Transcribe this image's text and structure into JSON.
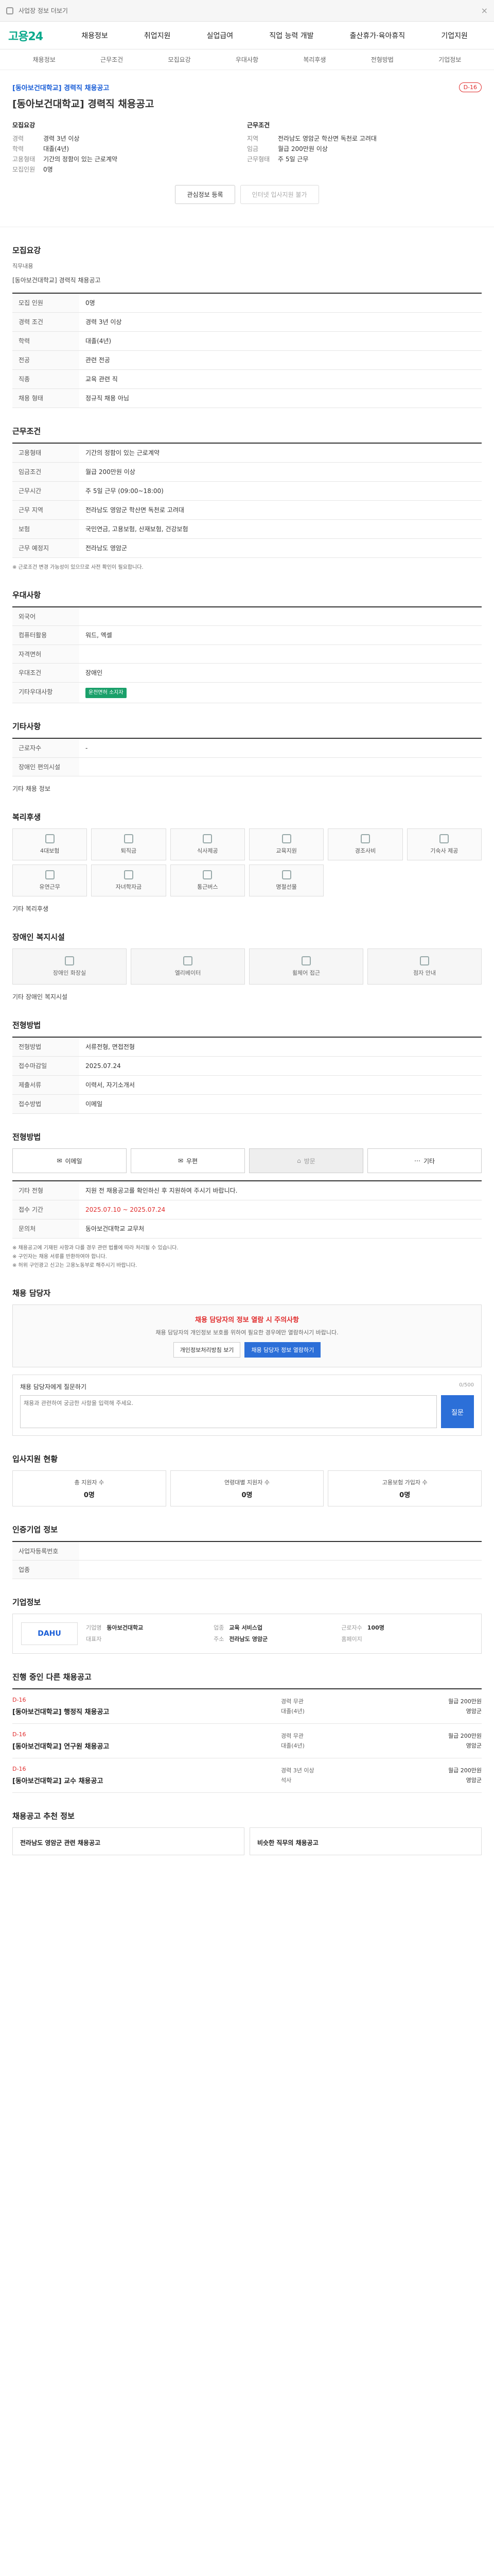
{
  "topbar": {
    "notice": "사업장 정보 더보기",
    "close": "×"
  },
  "gnb": {
    "logo_a": "고용",
    "logo_b": "24",
    "menu": [
      "채용정보",
      "취업지원",
      "실업급여",
      "직업 능력 개발",
      "출산휴가·육아휴직",
      "기업지원"
    ]
  },
  "subnav": [
    "채용정보",
    "근무조건",
    "모집요강",
    "우대사항",
    "복리후생",
    "전형방법",
    "기업정보"
  ],
  "job": {
    "company": "[동아보건대학교] 경력직 채용공고",
    "title": "[동아보건대학교] 경력직 채용공고",
    "badge": "D-16",
    "left_h": "모집요강",
    "right_h": "근무조건",
    "left": [
      [
        "경력",
        "경력 3년 이상"
      ],
      [
        "학력",
        "대졸(4년)"
      ],
      [
        "고용형태",
        "기간의 정함이 있는 근로계약"
      ],
      [
        "모집인원",
        "0명"
      ]
    ],
    "right": [
      [
        "지역",
        "전라남도 영암군 학산면 독천로 고려대"
      ],
      [
        "임금",
        "월급 200만원 이상"
      ],
      [
        "근무형태",
        "주 5일 근무"
      ]
    ],
    "btn1": "관심정보 등록",
    "btn2": "인터넷 입사지원 불가"
  },
  "recruit": {
    "h": "모집요강",
    "sub": "직무내용",
    "desc": "[동아보건대학교] 경력직 채용공고",
    "rows": [
      [
        "모집 인원",
        "0명"
      ],
      [
        "경력 조건",
        "경력 3년 이상"
      ],
      [
        "학력",
        "대졸(4년)"
      ],
      [
        "전공",
        "관련 전공"
      ],
      [
        "직종",
        "교육 관련 직"
      ],
      [
        "채용 형태",
        "정규직 채용 아님"
      ]
    ]
  },
  "work": {
    "h": "근무조건",
    "rows": [
      [
        "고용형태",
        "기간의 정함이 있는 근로계약"
      ],
      [
        "임금조건",
        "월급 200만원 이상"
      ],
      [
        "근무시간",
        "주 5일 근무 (09:00~18:00)"
      ],
      [
        "근무 지역",
        "전라남도 영암군 학산면 독천로 고려대"
      ],
      [
        "보험",
        "국민연금, 고용보험, 산재보험, 건강보험"
      ],
      [
        "근무 예정지",
        "전라남도 영암군"
      ]
    ],
    "note": "※ 근로조건 변경 가능성이 있으므로 사전 확인이 필요합니다."
  },
  "pref": {
    "h": "우대사항",
    "rows": [
      [
        "외국어",
        ""
      ],
      [
        "컴퓨터활용",
        "워드, 엑셀"
      ],
      [
        "자격면허",
        ""
      ],
      [
        "우대조건",
        "장애인"
      ],
      [
        "기타우대사항",
        "운전면허 소지자"
      ]
    ]
  },
  "etc": {
    "h": "기타사항",
    "rows": [
      [
        "근로자수",
        "-"
      ],
      [
        "장애인 편의시설",
        ""
      ]
    ],
    "more": "기타 채용 정보"
  },
  "welfare": {
    "h": "복리후생",
    "items": [
      "4대보험",
      "퇴직금",
      "식사제공",
      "교육지원",
      "경조사비",
      "기숙사 제공"
    ],
    "items2": [
      "유연근무",
      "자녀학자금",
      "통근버스",
      "명절선물"
    ],
    "label": "기타 복리후생"
  },
  "disabled": {
    "h": "장애인 복지시설",
    "items": [
      "장애인 화장실",
      "엘리베이터",
      "휠체어 접근",
      "점자 안내"
    ],
    "label": "기타 장애인 복지시설"
  },
  "screen": {
    "h": "전형방법",
    "rows": [
      [
        "전형방법",
        "서류전형, 면접전형"
      ],
      [
        "접수마감일",
        "2025.07.24"
      ],
      [
        "제출서류",
        "이력서, 자기소개서"
      ],
      [
        "접수방법",
        "이메일"
      ]
    ]
  },
  "apply": {
    "h": "전형방법",
    "methods": [
      "이메일",
      "우편",
      "방문",
      "기타"
    ],
    "rows": [
      [
        "기타 전형",
        "지원 전 채용공고를 확인하신 후 지원하여 주시기 바랍니다."
      ],
      [
        "접수 기간",
        "2025.07.10 ~ 2025.07.24"
      ],
      [
        "문의처",
        "동아보건대학교 교무처"
      ]
    ]
  },
  "notice": [
    "※ 채용공고에 기재된 사항과 다를 경우 관련 법률에 따라 처리될 수 있습니다.",
    "※ 구인자는 채용 서류를 반환하여야 합니다.",
    "※ 허위 구인광고 신고는 고용노동부로 해주시기 바랍니다."
  ],
  "qa": {
    "h": "채용 담당자",
    "warn": "채용 담당자의 정보 열람 시 주의사항",
    "p": "채용 담당자의 개인정보 보호를 위하여 필요한 경우에만 열람하시기 바랍니다.",
    "b1": "개인정보처리방침 보기",
    "b2": "채용 담당자 정보 열람하기",
    "label": "채용 담당자에게 질문하기",
    "count": "0/500",
    "ph": "채용과 관련하여 궁금한 사항을 입력해 주세요.",
    "send": "질문"
  },
  "stats": {
    "h": "입사지원 현황",
    "items": [
      [
        "총 지원자 수",
        "0명"
      ],
      [
        "연령대별 지원자 수",
        "0명"
      ],
      [
        "고용보험 가입자 수",
        "0명"
      ]
    ]
  },
  "ref": {
    "h": "인증기업 정보",
    "rows": [
      [
        "사업자등록번호",
        ""
      ],
      [
        "업종",
        ""
      ]
    ]
  },
  "corp": {
    "h": "기업정보",
    "logo": "DAHU",
    "kvs": [
      [
        "기업명",
        "동아보건대학교"
      ],
      [
        "업종",
        "교육 서비스업"
      ],
      [
        "근로자수",
        "100명"
      ],
      [
        "대표자",
        ""
      ],
      [
        "주소",
        "전라남도 영암군"
      ],
      [
        "홈페이지",
        ""
      ]
    ]
  },
  "history": {
    "h": "진행 중인 다른 채용공고",
    "items": [
      {
        "d": "D-16",
        "t": "[동아보건대학교] 행정직 채용공고",
        "m1": "경력 무관",
        "m2": "대졸(4년)",
        "r1": "월급 200만원",
        "r2": "영암군"
      },
      {
        "d": "D-16",
        "t": "[동아보건대학교] 연구원 채용공고",
        "m1": "경력 무관",
        "m2": "대졸(4년)",
        "r1": "월급 200만원",
        "r2": "영암군"
      },
      {
        "d": "D-16",
        "t": "[동아보건대학교] 교수 채용공고",
        "m1": "경력 3년 이상",
        "m2": "석사",
        "r1": "월급 200만원",
        "r2": "영암군"
      }
    ]
  },
  "recs": {
    "h": "채용공고 추천 정보",
    "items": [
      "전라남도 영암군 관련 채용공고",
      "비슷한 직무의 채용공고"
    ]
  }
}
